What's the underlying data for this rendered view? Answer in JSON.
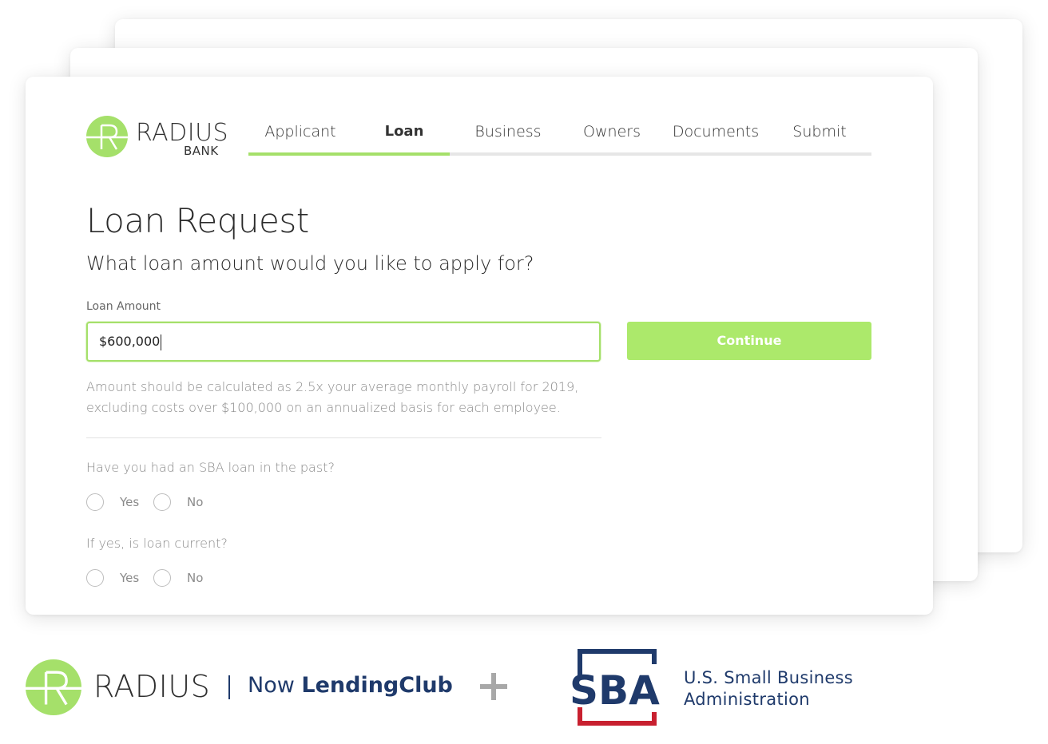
{
  "header": {
    "brand_name": "RADIUS",
    "brand_sub": "BANK",
    "logo_letter": "R"
  },
  "tabs": [
    {
      "label": "Applicant",
      "active": false
    },
    {
      "label": "Loan",
      "active": true
    },
    {
      "label": "Business",
      "active": false
    },
    {
      "label": "Owners",
      "active": false
    },
    {
      "label": "Documents",
      "active": false
    },
    {
      "label": "Submit",
      "active": false
    }
  ],
  "progress": {
    "completed_steps": 2,
    "total_steps": 6
  },
  "form": {
    "title": "Loan Request",
    "subtitle": "What loan amount would you like to apply for?",
    "amount_label": "Loan Amount",
    "amount_value": "$600,000",
    "continue_label": "Continue",
    "help_line1": "Amount should be calculated as 2.5x your average monthly payroll for 2019,",
    "help_line2": "excluding costs over $100,000 on an annualized basis for each employee.",
    "q1": "Have you had an SBA loan in the past?",
    "q2": "If yes, is loan current?",
    "yes_label": "Yes",
    "no_label": "No"
  },
  "footer": {
    "radius_text": "RADIUS",
    "now_text": "Now ",
    "lendingclub_text": "LendingClub",
    "sba_text": "SBA",
    "sba_line1": "U.S. Small Business",
    "sba_line2": "Administration"
  },
  "colors": {
    "accent_green": "#a5e06a",
    "navy": "#1f3a6b",
    "sba_red": "#c8202f"
  },
  "icons": {
    "plus": "plus-icon",
    "caret": "text-caret"
  }
}
